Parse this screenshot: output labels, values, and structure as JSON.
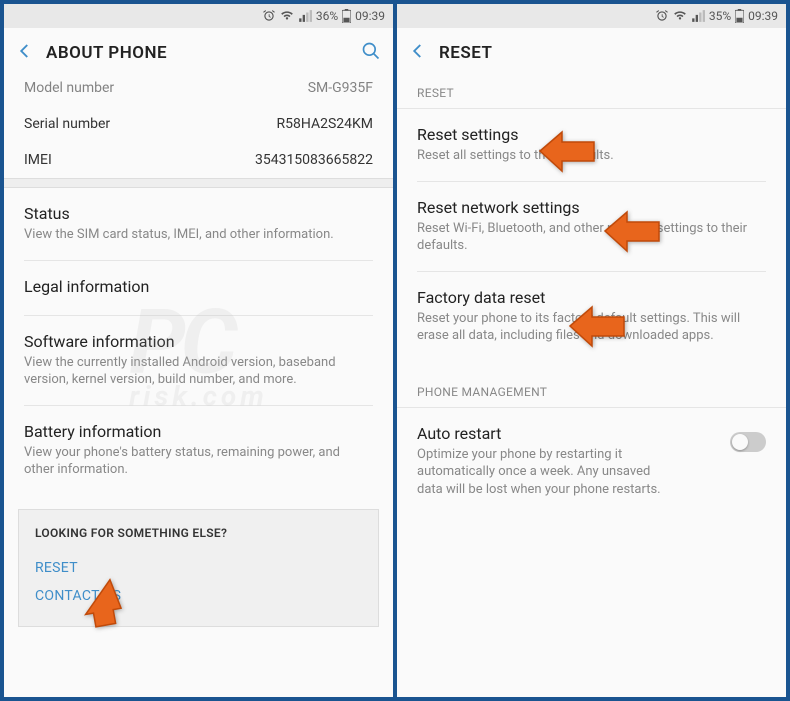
{
  "left": {
    "status": {
      "battery_pct": "36%",
      "time": "09:39"
    },
    "header": {
      "title": "ABOUT PHONE"
    },
    "info": {
      "model_label": "Model number",
      "model_value": "SM-G935F",
      "serial_label": "Serial number",
      "serial_value": "R58HA2S24KM",
      "imei_label": "IMEI",
      "imei_value": "354315083665822"
    },
    "items": {
      "status_title": "Status",
      "status_desc": "View the SIM card status, IMEI, and other information.",
      "legal_title": "Legal information",
      "software_title": "Software information",
      "software_desc": "View the currently installed Android version, baseband version, kernel version, build number, and more.",
      "battery_title": "Battery information",
      "battery_desc": "View your phone's battery status, remaining power, and other information."
    },
    "footer": {
      "heading": "LOOKING FOR SOMETHING ELSE?",
      "reset": "RESET",
      "contact": "CONTACT US"
    }
  },
  "right": {
    "status": {
      "battery_pct": "35%",
      "time": "09:39"
    },
    "header": {
      "title": "RESET"
    },
    "sections": {
      "reset": "RESET",
      "phone_mgmt": "PHONE MANAGEMENT"
    },
    "items": {
      "reset_settings_title": "Reset settings",
      "reset_settings_desc": "Reset all settings to their defaults.",
      "reset_network_title": "Reset network settings",
      "reset_network_desc": "Reset Wi-Fi, Bluetooth, and other network settings to their defaults.",
      "factory_title": "Factory data reset",
      "factory_desc": "Reset your phone to its factory default settings. This will erase all data, including files and downloaded apps.",
      "auto_restart_title": "Auto restart",
      "auto_restart_desc": "Optimize your phone by restarting it automatically once a week. Any unsaved data will be lost when your phone restarts."
    }
  }
}
